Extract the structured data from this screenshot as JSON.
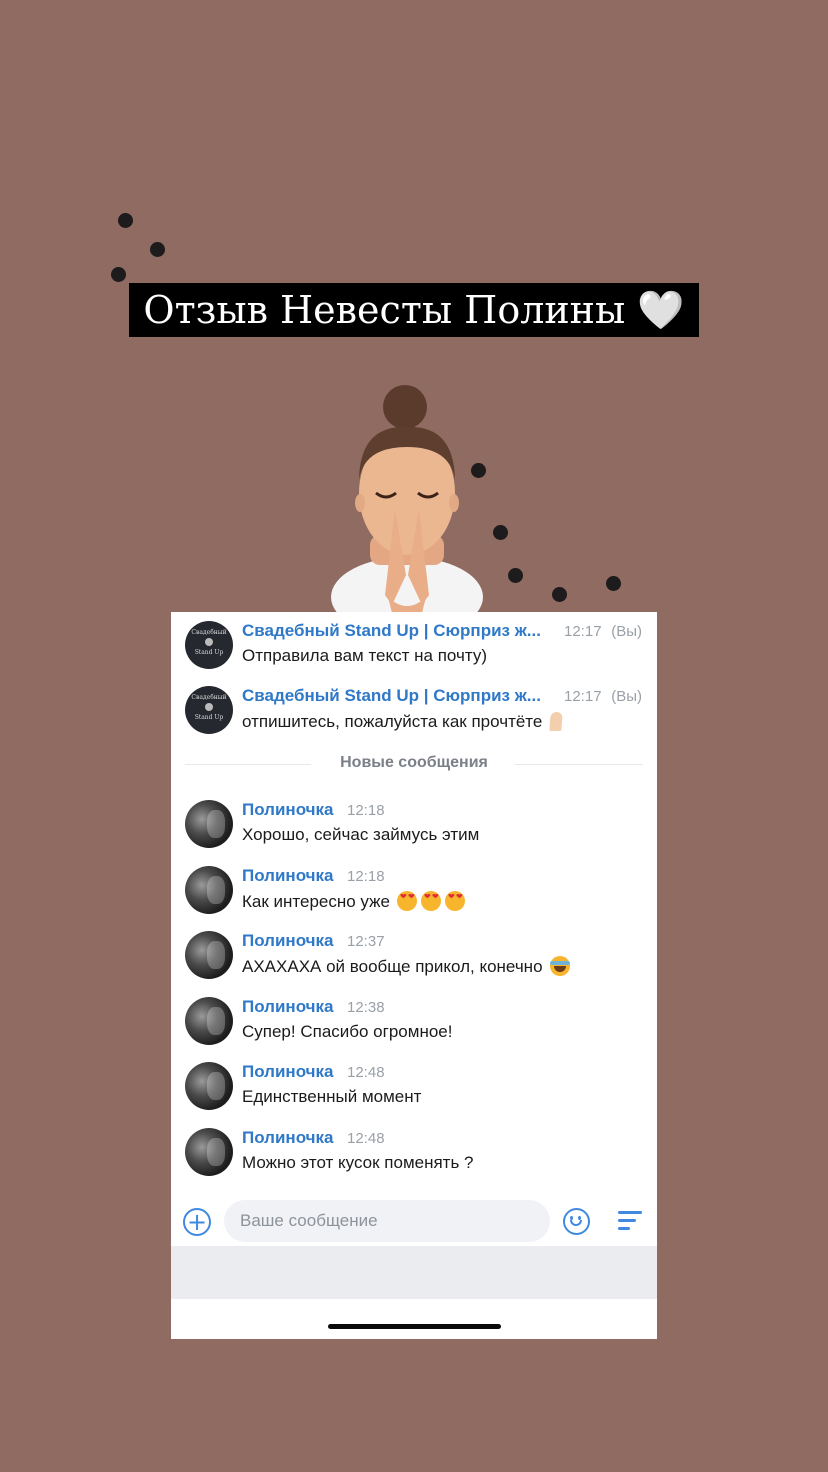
{
  "story": {
    "title": "Отзыв Невесты Полины",
    "heart": "🤍"
  },
  "chat": {
    "brand_avatar": {
      "line1": "Свадебный",
      "line2": "Stand Up"
    },
    "messages": [
      {
        "author": "Свадебный Stand Up | Сюрприз ж...",
        "time": "12:17",
        "you": "(Вы)",
        "text": "Отправила вам текст на почту)",
        "emoji": []
      },
      {
        "author": "Свадебный Stand Up | Сюрприз ж...",
        "time": "12:17",
        "you": "(Вы)",
        "text": "отпишитесь, пожалуйста как прочтёте",
        "emoji": [
          "folded-hands"
        ]
      },
      {
        "author": "Полиночка",
        "time": "12:18",
        "text": "Хорошо, сейчас займусь этим",
        "emoji": []
      },
      {
        "author": "Полиночка",
        "time": "12:18",
        "text": "Как интересно уже",
        "emoji": [
          "heart-eyes",
          "heart-eyes",
          "heart-eyes"
        ]
      },
      {
        "author": "Полиночка",
        "time": "12:37",
        "text": "АХАХАХА ой вообще прикол, конечно",
        "emoji": [
          "tears-of-joy"
        ]
      },
      {
        "author": "Полиночка",
        "time": "12:38",
        "text": "Супер! Спасибо огромное!",
        "emoji": []
      },
      {
        "author": "Полиночка",
        "time": "12:48",
        "text": "Единственный момент",
        "emoji": []
      },
      {
        "author": "Полиночка",
        "time": "12:48",
        "text": "Можно этот кусок поменять ?",
        "emoji": []
      }
    ],
    "divider_label": "Новые сообщения",
    "composer": {
      "placeholder": "Ваше сообщение",
      "icons": [
        "plus-icon",
        "smile-icon",
        "menu-icon"
      ]
    }
  },
  "colors": {
    "background": "#8f6b62",
    "link_blue": "#2f79c8",
    "accent_blue": "#3f8ae0"
  }
}
